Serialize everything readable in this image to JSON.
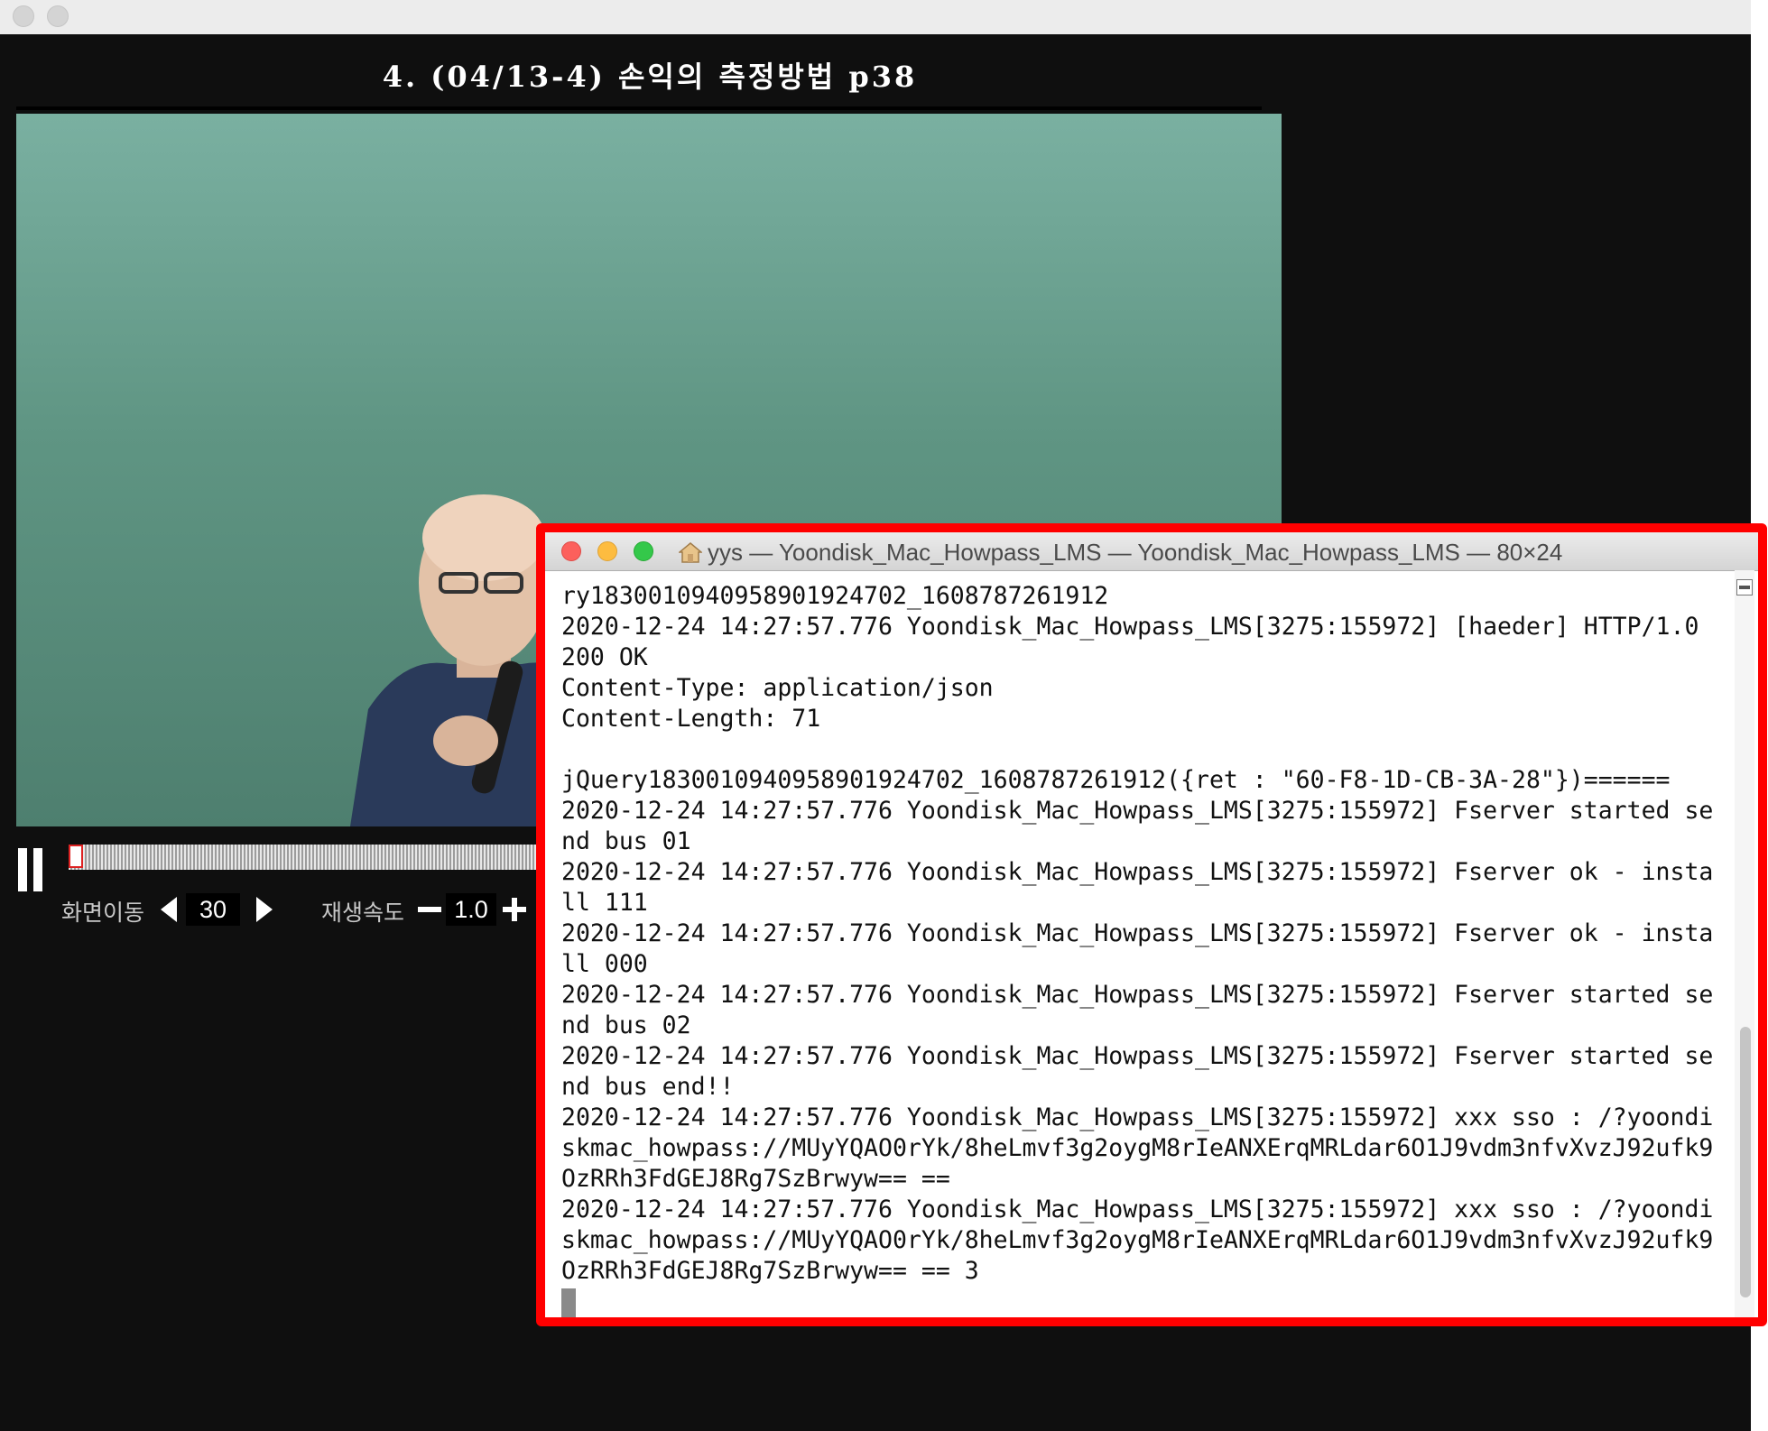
{
  "player": {
    "title": "4. (04/13-4) 손익의 측정방법 p38",
    "controls": {
      "seek_label": "화면이동",
      "seek_value": "30",
      "speed_label": "재생속도",
      "speed_value": "1.0",
      "progress_fraction": 0.0
    }
  },
  "terminal": {
    "title": "yys — Yoondisk_Mac_Howpass_LMS — Yoondisk_Mac_Howpass_LMS — 80×24",
    "lines": [
      "ry183001094095890192470​2_1608787261912",
      "2020-12-24 14:27:57.776 Yoondisk_Mac_Howpass_LMS[3275:155972] [haeder] HTTP/1.0",
      "200 OK",
      "Content-Type: application/json",
      "Content-Length: 71",
      "",
      "jQuery18300109409589019247​02_1608787261912({ret : \"60-F8-1D-CB-3A-28\"})======",
      "2020-12-24 14:27:57.776 Yoondisk_Mac_Howpass_LMS[3275:155972] Fserver started se",
      "nd bus 01",
      "2020-12-24 14:27:57.776 Yoondisk_Mac_Howpass_LMS[3275:155972] Fserver ok - insta",
      "ll 111",
      "2020-12-24 14:27:57.776 Yoondisk_Mac_Howpass_LMS[3275:155972] Fserver ok - insta",
      "ll 000",
      "2020-12-24 14:27:57.776 Yoondisk_Mac_Howpass_LMS[3275:155972] Fserver started se",
      "nd bus 02",
      "2020-12-24 14:27:57.776 Yoondisk_Mac_Howpass_LMS[3275:155972] Fserver started se",
      "nd bus end!!",
      "2020-12-24 14:27:57.776 Yoondisk_Mac_Howpass_LMS[3275:155972] xxx sso : /?yoondi",
      "skmac_howpass://MUyYQAO0rYk/8heLmvf3g2oygM8rIeANXErqMRLdar6O1J9vdm3nfvXvzJ92ufk9",
      "OzRRh3FdGEJ8Rg7SzBrwyw== ==",
      "2020-12-24 14:27:57.776 Yoondisk_Mac_Howpass_LMS[3275:155972] xxx sso : /?yoondi",
      "skmac_howpass://MUyYQAO0rYk/8heLmvf3g2oygM8rIeANXErqMRLdar6O1J9vdm3nfvXvzJ92ufk9",
      "OzRRh3FdGEJ8Rg7SzBrwyw== == 3"
    ]
  },
  "colors": {
    "highlight_border": "#ff0000",
    "player_bg": "#0f0f0f",
    "close": "#fc605c",
    "minimize": "#fdbc40",
    "zoom": "#34c84a"
  }
}
